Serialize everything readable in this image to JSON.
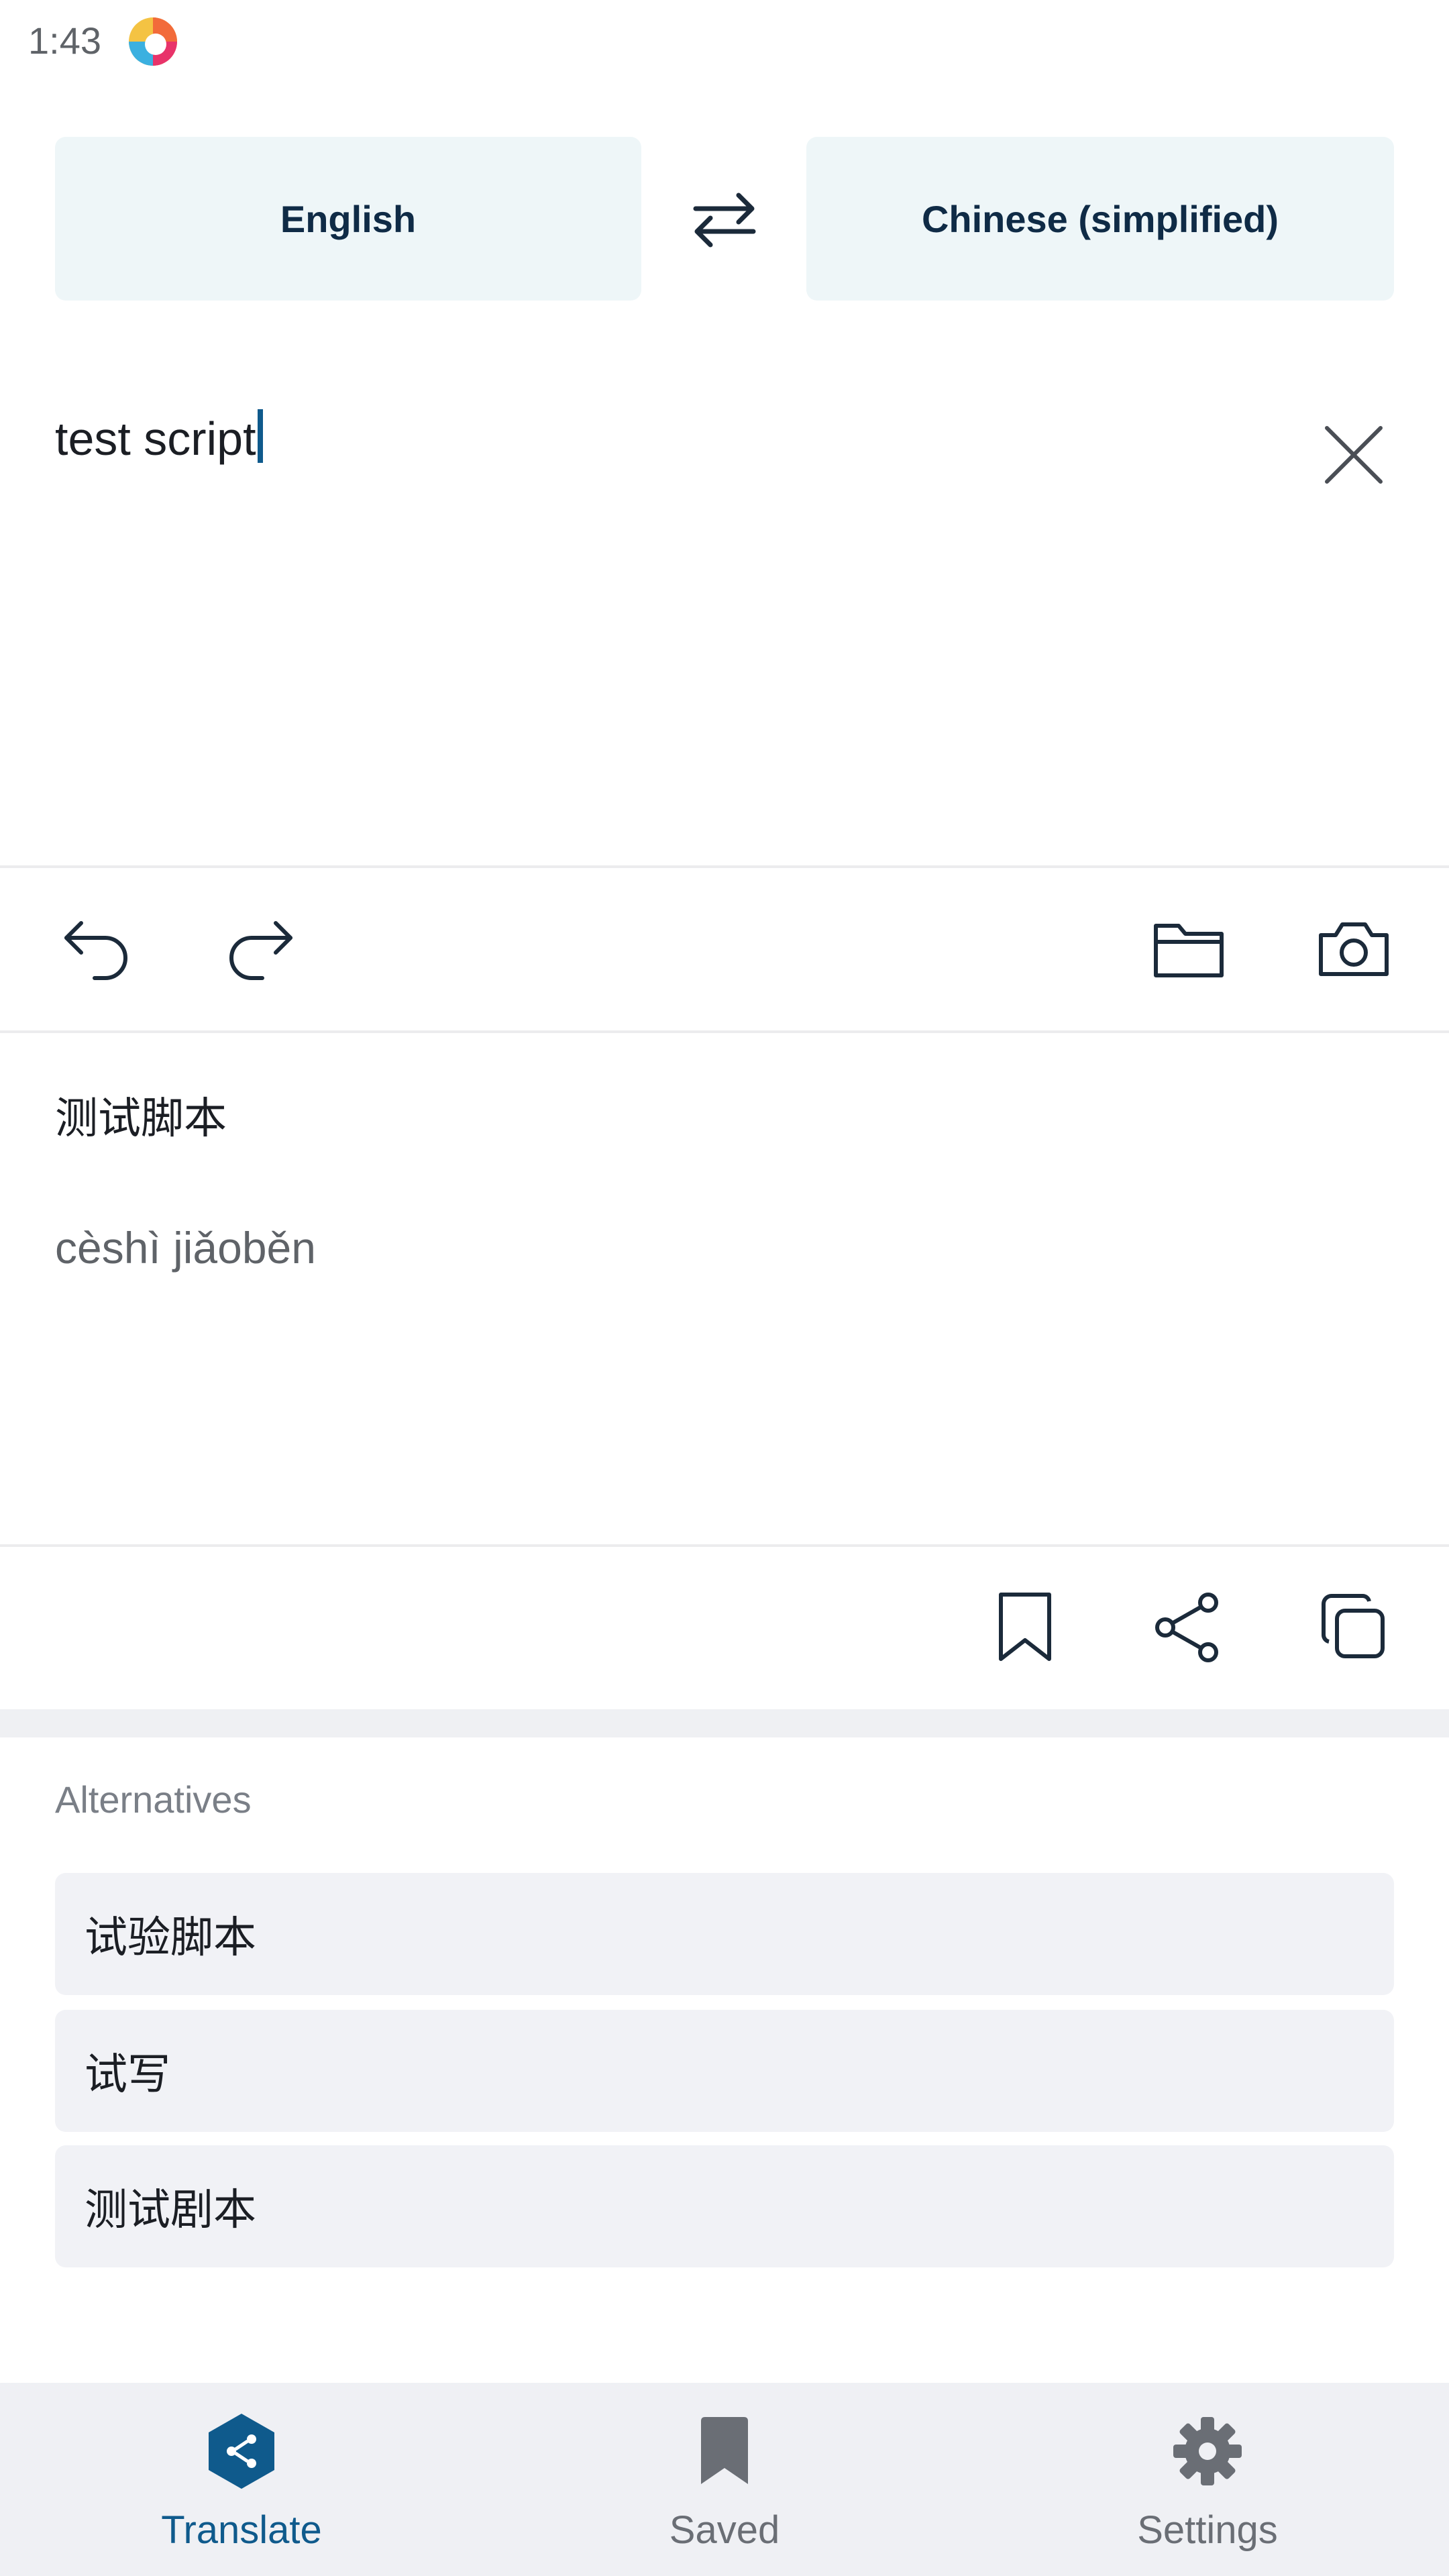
{
  "status_bar": {
    "time": "1:43"
  },
  "languages": {
    "source": "English",
    "target": "Chinese (simplified)"
  },
  "input": {
    "text": "test script"
  },
  "result": {
    "translation": "测试脚本",
    "pinyin": "cèshì jiǎoběn"
  },
  "alternatives": {
    "heading": "Alternatives",
    "items": [
      "试验脚本",
      "试写",
      "测试剧本"
    ]
  },
  "bottom_nav": {
    "translate": "Translate",
    "saved": "Saved",
    "settings": "Settings"
  },
  "colors": {
    "accent": "#0f5a8c",
    "language_button_bg": "#eef6f8",
    "alt_item_bg": "#f1f2f6",
    "nav_bg": "#eff0f4"
  }
}
